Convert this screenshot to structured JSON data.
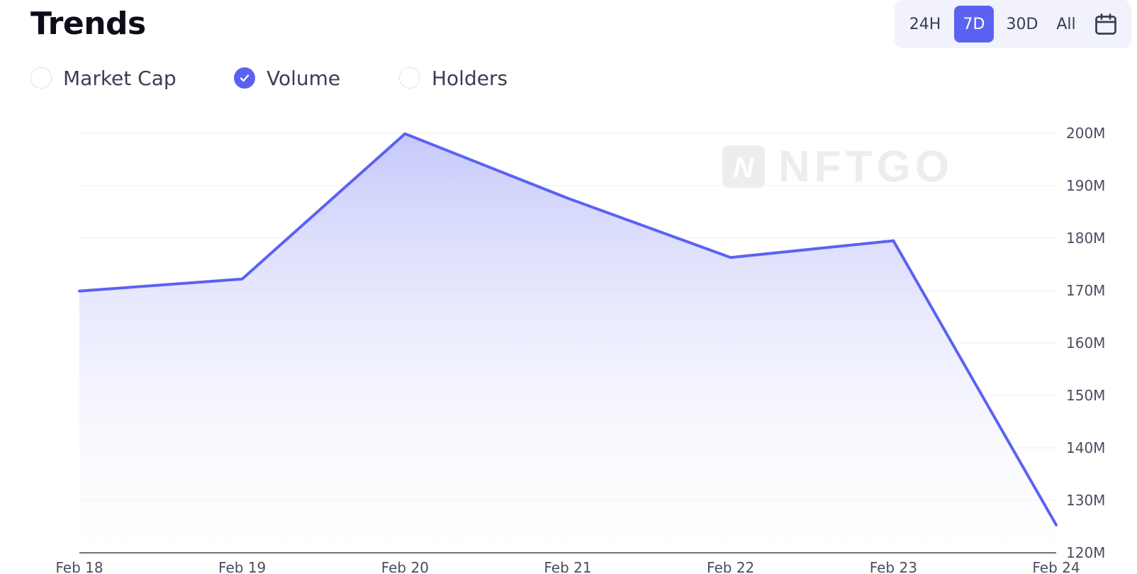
{
  "header": {
    "title": "Trends"
  },
  "ranges": [
    {
      "label": "24H",
      "active": false
    },
    {
      "label": "7D",
      "active": true
    },
    {
      "label": "30D",
      "active": false
    },
    {
      "label": "All",
      "active": false
    }
  ],
  "calendar_icon": "calendar-icon",
  "metrics": [
    {
      "label": "Market Cap",
      "checked": false
    },
    {
      "label": "Volume",
      "checked": true
    },
    {
      "label": "Holders",
      "checked": false
    }
  ],
  "watermark": "NFTGO",
  "colors": {
    "accent": "#5b62f2",
    "line": "#5b62f2",
    "fill_top": "#c9cbfb"
  },
  "chart_data": {
    "type": "area",
    "categories": [
      "Feb 18",
      "Feb 19",
      "Feb 20",
      "Feb 21",
      "Feb 22",
      "Feb 23",
      "Feb 24"
    ],
    "values": [
      169.9,
      172.2,
      199.9,
      187.6,
      176.3,
      179.5,
      125.3
    ],
    "y_ticks": [
      "200M",
      "190M",
      "180M",
      "170M",
      "160M",
      "150M",
      "140M",
      "130M",
      "120M"
    ],
    "ylim": [
      120,
      200
    ],
    "grid": true,
    "y_axis_position": "right"
  }
}
